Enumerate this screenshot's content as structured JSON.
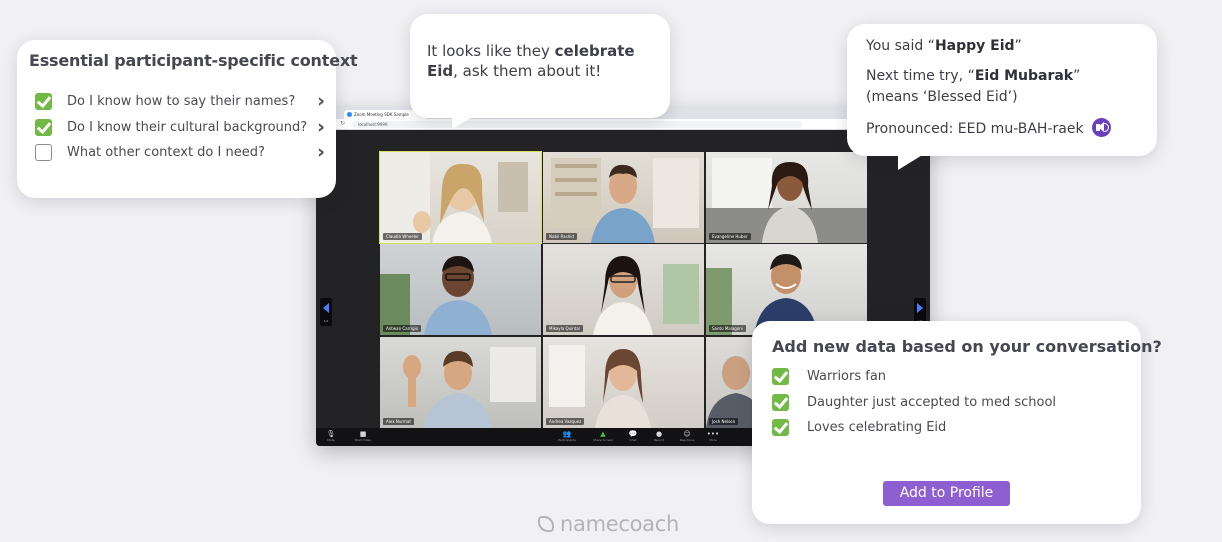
{
  "brand": {
    "logo_text": "namecoach"
  },
  "colors": {
    "accent": "#8e5fd1",
    "check": "#72b946",
    "speaker": "#6c3fbf",
    "toolbar": "#121214"
  },
  "context_card": {
    "title": "Essential participant-specific context",
    "items": [
      {
        "label": "Do I know how to say their names?",
        "checked": true
      },
      {
        "label": "Do I know their cultural background?",
        "checked": true
      },
      {
        "label": "What other context do I need?",
        "checked": false
      }
    ],
    "chevron_icon": "chevron-right-icon"
  },
  "suggestion_bubble": {
    "text_before": "It looks like they ",
    "text_bold": "celebrate Eid",
    "text_after": ", ask them about it!"
  },
  "pronunciation_bubble": {
    "line1_before": "You said “",
    "line1_bold": "Happy Eid",
    "line1_after": "”",
    "line2_before": "Next time try, “",
    "line2_bold": "Eid Mubarak",
    "line2_after": "”",
    "line3": "(means ‘Blessed Eid’)",
    "line4": "Pronounced: EED mu-BAH-raek",
    "icon": "speaker-icon"
  },
  "browser": {
    "tab_title": "Zoom Meeting SDK Sample",
    "url": "localhost:9999"
  },
  "meeting": {
    "page_indicator": "1/2",
    "participants": [
      {
        "name": "Claudia Wheeler"
      },
      {
        "name": "Nabil Rashid"
      },
      {
        "name": "Evangeline Huber"
      },
      {
        "name": "Antwan Carrigio"
      },
      {
        "name": "Mikayla Quintal"
      },
      {
        "name": "Santo Malagoni"
      },
      {
        "name": "Alex Nurmat"
      },
      {
        "name": "Andrea Vazquez"
      },
      {
        "name": "Josh Nelson"
      }
    ],
    "toolbar": {
      "mute": "Mute",
      "video": "Start Video",
      "participants": "Participants",
      "share": "Share Screen",
      "chat": "Chat",
      "record": "Record",
      "reactions": "Reactions",
      "more": "More"
    }
  },
  "add_data_card": {
    "title": "Add new data based on your conversation?",
    "items": [
      {
        "label": "Warriors fan",
        "checked": true
      },
      {
        "label": "Daughter just accepted to med school",
        "checked": true
      },
      {
        "label": "Loves celebrating Eid",
        "checked": true
      }
    ],
    "button_label": "Add to Profile"
  }
}
